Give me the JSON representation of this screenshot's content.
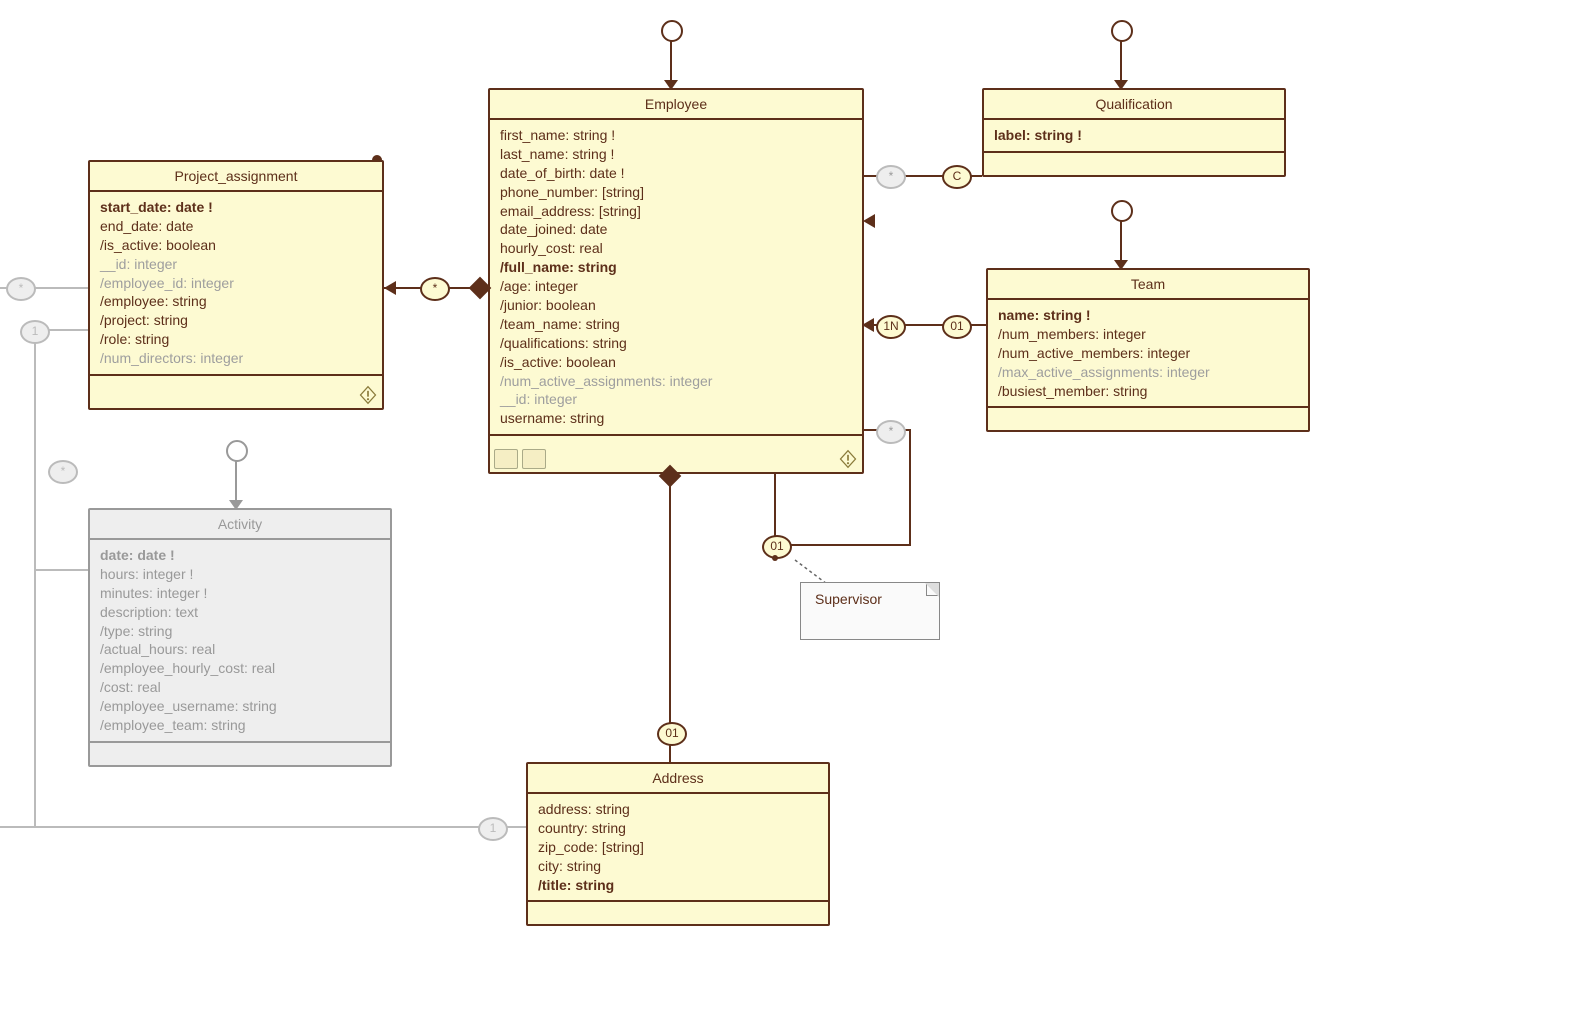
{
  "classes": {
    "employee": {
      "title": "Employee",
      "attrs": [
        {
          "text": "first_name: string !"
        },
        {
          "text": "last_name: string !"
        },
        {
          "text": "date_of_birth: date !"
        },
        {
          "text": "phone_number: [string]"
        },
        {
          "text": "email_address: [string]"
        },
        {
          "text": "date_joined: date"
        },
        {
          "text": "hourly_cost: real"
        },
        {
          "text": "/full_name: string",
          "bold": true
        },
        {
          "text": "/age: integer"
        },
        {
          "text": "/junior: boolean"
        },
        {
          "text": "/team_name: string"
        },
        {
          "text": "/qualifications: string"
        },
        {
          "text": "/is_active: boolean"
        },
        {
          "text": "/num_active_assignments: integer",
          "muted": true
        },
        {
          "text": "__id: integer",
          "muted": true
        },
        {
          "text": "username: string"
        }
      ]
    },
    "project_assignment": {
      "title": "Project_assignment",
      "attrs": [
        {
          "text": "start_date: date !",
          "bold": true
        },
        {
          "text": "end_date: date"
        },
        {
          "text": "/is_active: boolean"
        },
        {
          "text": "__id: integer",
          "muted": true
        },
        {
          "text": "/employee_id: integer",
          "muted": true
        },
        {
          "text": "/employee: string"
        },
        {
          "text": "/project: string"
        },
        {
          "text": "/role: string"
        },
        {
          "text": "/num_directors: integer",
          "muted": true
        }
      ]
    },
    "qualification": {
      "title": "Qualification",
      "attrs": [
        {
          "text": "label: string !",
          "bold": true
        }
      ]
    },
    "team": {
      "title": "Team",
      "attrs": [
        {
          "text": "name: string !",
          "bold": true
        },
        {
          "text": "/num_members: integer"
        },
        {
          "text": "/num_active_members: integer"
        },
        {
          "text": "/max_active_assignments: integer",
          "muted": true
        },
        {
          "text": "/busiest_member: string"
        }
      ]
    },
    "address": {
      "title": "Address",
      "attrs": [
        {
          "text": "address: string"
        },
        {
          "text": "country: string"
        },
        {
          "text": "zip_code: [string]"
        },
        {
          "text": "city: string"
        },
        {
          "text": "/title: string",
          "bold": true
        }
      ]
    },
    "activity": {
      "title": "Activity",
      "attrs": [
        {
          "text": "date: date !",
          "bold": true
        },
        {
          "text": "hours: integer !"
        },
        {
          "text": "minutes: integer !"
        },
        {
          "text": "description: text"
        },
        {
          "text": "/type: string"
        },
        {
          "text": "/actual_hours: real"
        },
        {
          "text": "/employee_hourly_cost: real"
        },
        {
          "text": "/cost: real"
        },
        {
          "text": "/employee_username: string"
        },
        {
          "text": "/employee_team: string"
        }
      ]
    }
  },
  "note_supervisor": "Supervisor",
  "multiplicities": {
    "pa_emp_star": "*",
    "pa_left_star_1": "*",
    "pa_left_one": "1",
    "act_star": "*",
    "act_one": "1",
    "emp_qual_star": "*",
    "emp_qual_C": "C",
    "emp_team_1N": "1N",
    "emp_team_01": "01",
    "emp_self_star": "*",
    "emp_self_01": "01",
    "emp_addr_01": "01"
  }
}
